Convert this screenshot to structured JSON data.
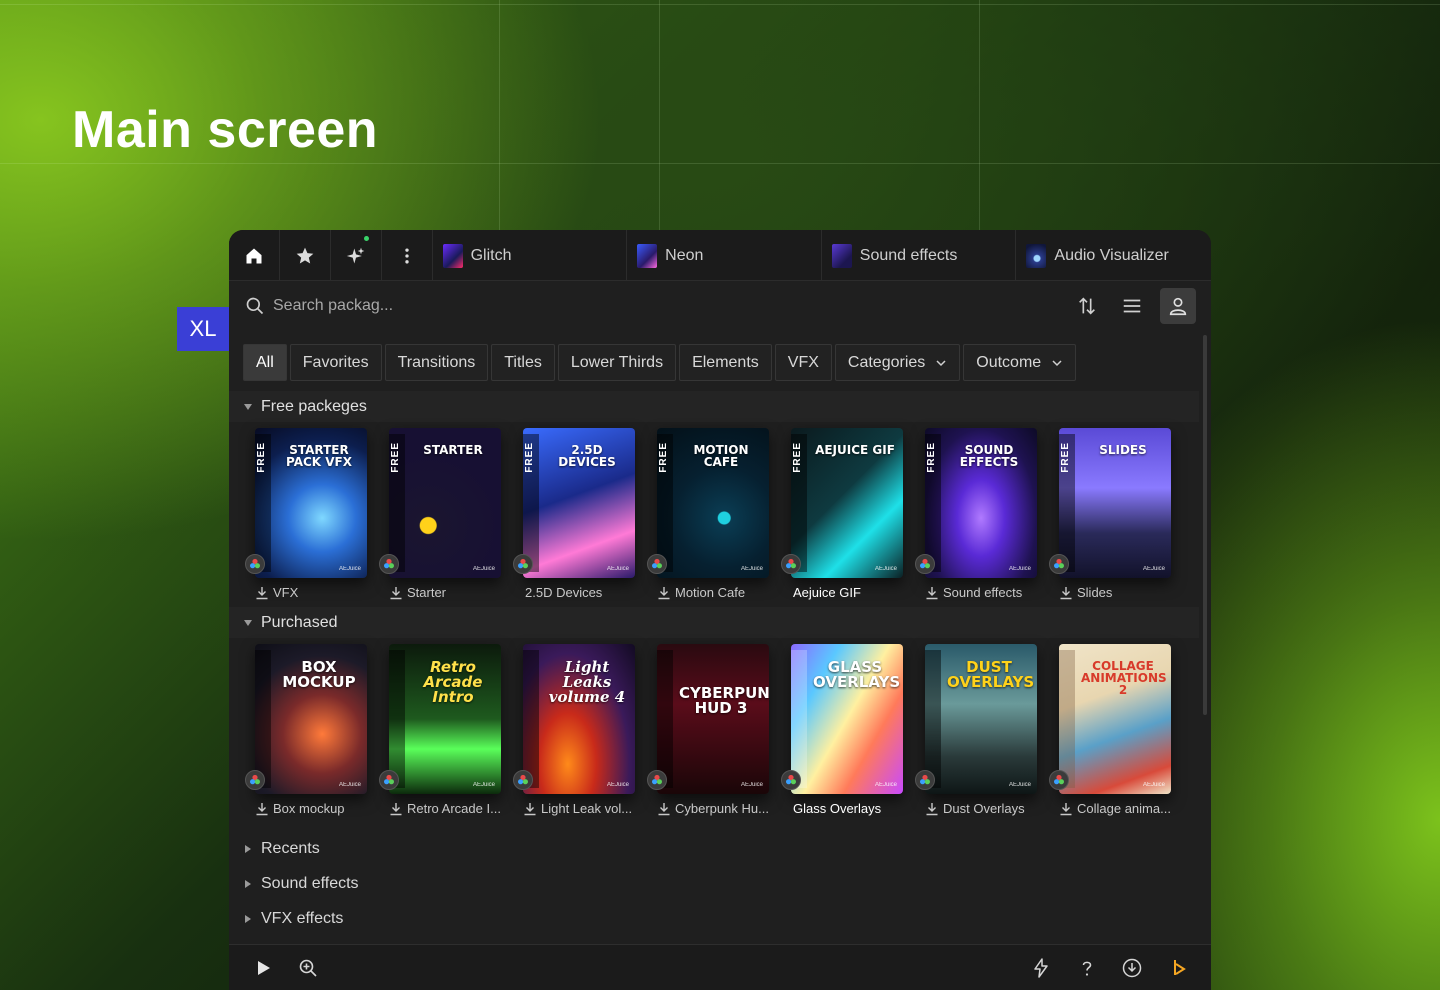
{
  "hero": {
    "title": "Main screen"
  },
  "badge": {
    "size_label": "XL"
  },
  "colors": {
    "accent": "#3a3fd6",
    "green_dot": "#3ad46a",
    "brand_orange": "#f5a623"
  },
  "tabbar": {
    "icons": [
      "home-icon",
      "star-icon",
      "sparkle-icon",
      "more-vertical-icon"
    ],
    "tabs": [
      {
        "label": "Glitch"
      },
      {
        "label": "Neon"
      },
      {
        "label": "Sound effects"
      },
      {
        "label": "Audio Visualizer"
      }
    ]
  },
  "search": {
    "placeholder": "Search packag...",
    "value": ""
  },
  "filters": {
    "items": [
      "All",
      "Favorites",
      "Transitions",
      "Titles",
      "Lower Thirds",
      "Elements",
      "VFX"
    ],
    "categories_label": "Categories",
    "outcome_label": "Outcome",
    "active": "All"
  },
  "sections": {
    "free": {
      "title": "Free packeges",
      "items": [
        {
          "box": "STARTER PACK VFX",
          "label": "VFX",
          "badge": "FREE"
        },
        {
          "box": "STARTER",
          "label": "Starter",
          "badge": "FREE"
        },
        {
          "box": "2.5D DEVICES",
          "label": "2.5D Devices",
          "badge": "FREE"
        },
        {
          "box": "MOTION CAFE",
          "label": "Motion Cafe",
          "badge": "FREE"
        },
        {
          "box": "AEJUICE GIF",
          "label": "Aejuice GIF",
          "badge": "FREE"
        },
        {
          "box": "SOUND EFFECTS",
          "label": "Sound effects",
          "badge": "FREE"
        },
        {
          "box": "SLIDES",
          "label": "Slides",
          "badge": "FREE"
        }
      ]
    },
    "purchased": {
      "title": "Purchased",
      "items": [
        {
          "box": "BOX MOCKUP",
          "label": "Box mockup"
        },
        {
          "box": "Retro Arcade Intro",
          "label": "Retro Arcade I..."
        },
        {
          "box": "Light Leaks volume 4",
          "label": "Light Leak vol..."
        },
        {
          "box": "CYBERPUNK HUD 3",
          "label": "Cyberpunk Hu..."
        },
        {
          "box": "GLASS OVERLAYS",
          "label": "Glass Overlays"
        },
        {
          "box": "DUST OVERLAYS",
          "label": "Dust Overlays"
        },
        {
          "box": "COLLAGE ANIMATIONS 2",
          "label": "Collage anima..."
        }
      ]
    },
    "collapsed": [
      "Recents",
      "Sound effects",
      "VFX effects"
    ]
  },
  "brand_small": "AEJuice",
  "footer": {
    "icons": [
      "play-icon",
      "zoom-in-icon",
      "lightning-icon",
      "help-icon",
      "download-circle-icon",
      "aejuice-logo-icon"
    ]
  }
}
